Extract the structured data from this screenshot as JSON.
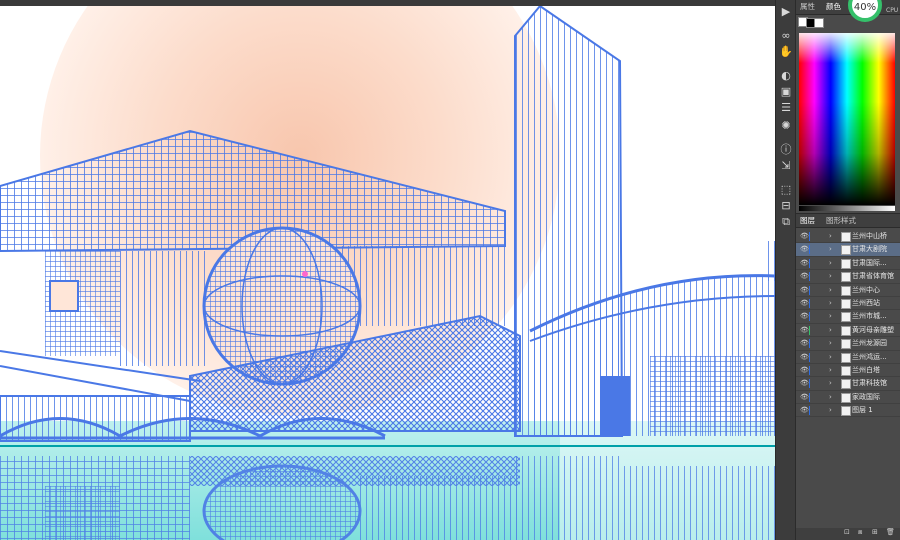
{
  "panel_tabs": [
    "属性",
    "颜色"
  ],
  "cpu": {
    "value": "40%",
    "label": "CPU"
  },
  "layers_tabs": [
    "图层",
    "图形样式"
  ],
  "layers": [
    {
      "name": "兰州中山桥",
      "color": "#2f6de1",
      "selected": false
    },
    {
      "name": "甘肃大剧院",
      "color": "#2f6de1",
      "selected": true
    },
    {
      "name": "甘肃国际...",
      "color": "#2f6de1",
      "selected": false
    },
    {
      "name": "甘肃省体育馆",
      "color": "#2f6de1",
      "selected": false
    },
    {
      "name": "兰州中心",
      "color": "#2f6de1",
      "selected": false
    },
    {
      "name": "兰州西站",
      "color": "#2f6de1",
      "selected": false
    },
    {
      "name": "兰州市城...",
      "color": "#2f6de1",
      "selected": false
    },
    {
      "name": "黄河母亲雕塑",
      "color": "#35c06a",
      "selected": false
    },
    {
      "name": "兰州龙源园",
      "color": "#2f6de1",
      "selected": false
    },
    {
      "name": "兰州鸿运...",
      "color": "#2f6de1",
      "selected": false
    },
    {
      "name": "兰州白塔",
      "color": "#2f6de1",
      "selected": false
    },
    {
      "name": "甘肃科技馆",
      "color": "#2f6de1",
      "selected": false
    },
    {
      "name": "家政国际",
      "color": "#2f6de1",
      "selected": false
    },
    {
      "name": "图层 1",
      "color": "#2f6de1",
      "selected": false
    }
  ],
  "tools": [
    "play-icon",
    "link-icon",
    "hand-icon",
    "color-icon",
    "gradient-icon",
    "lines-icon",
    "sun-icon",
    "info-icon",
    "export-icon",
    "transform-icon",
    "align-icon",
    "pathfinder-icon"
  ],
  "colors": {
    "wire": "#4a78e6",
    "sun": "#fbd9c6",
    "water": "#9fe6e2",
    "accent": "#35c06a"
  }
}
